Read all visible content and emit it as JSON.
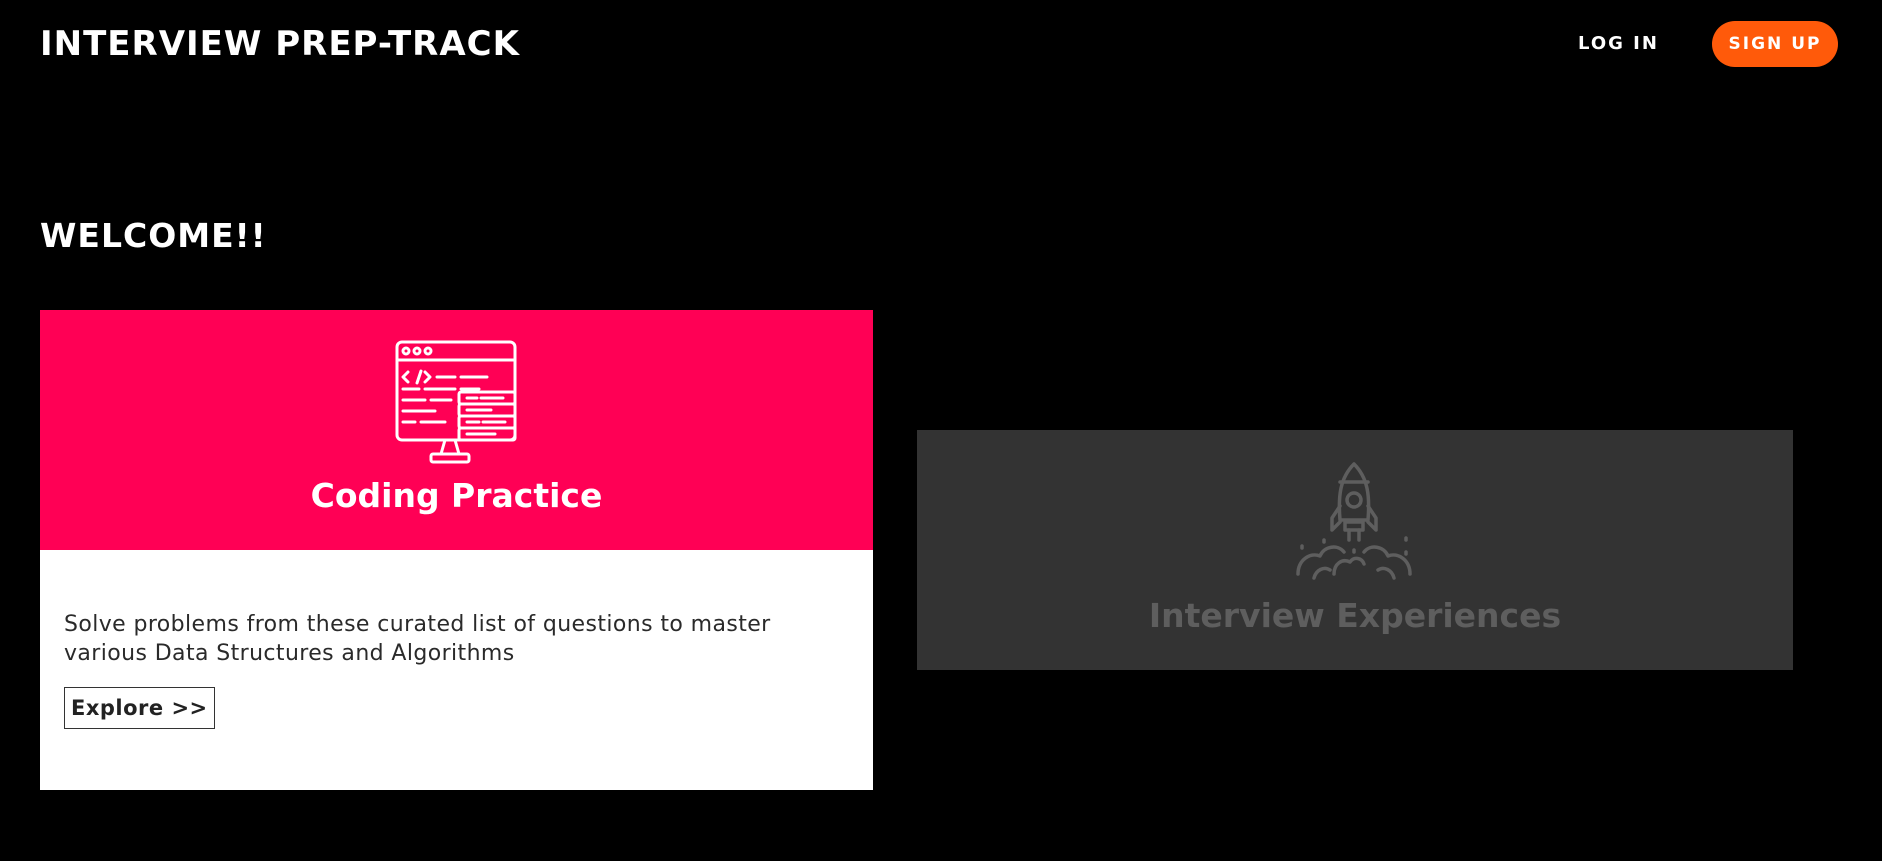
{
  "header": {
    "brand": "INTERVIEW PREP-TRACK",
    "login_label": "LOG IN",
    "signup_label": "SIGN UP"
  },
  "welcome": {
    "heading": "WELCOME!!"
  },
  "cards": {
    "coding": {
      "title": "Coding Practice",
      "description": "Solve problems from these curated list of questions to master various Data Structures and Algorithms",
      "button_label": "Explore >>",
      "icon": "code-window-icon"
    },
    "experiences": {
      "title": "Interview Experiences",
      "icon": "rocket-launch-icon"
    }
  },
  "colors": {
    "background": "#000000",
    "accent_pink": "#ff0055",
    "signup_orange": "#ff5a0a",
    "card_gray": "#333333"
  }
}
